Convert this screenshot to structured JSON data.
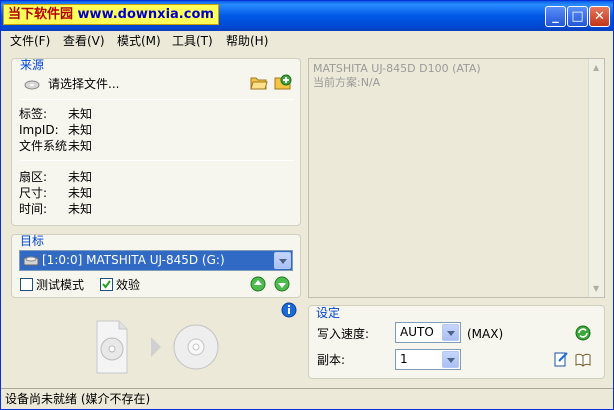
{
  "titlebar": {
    "brand_cn": "当下软件园",
    "brand_url": "www.downxia.com"
  },
  "menu": [
    "文件(F)",
    "查看(V)",
    "模式(M)",
    "工具(T)",
    "帮助(H)"
  ],
  "source": {
    "title": "来源",
    "select_file": "请选择文件...",
    "label_tag": "标签:",
    "value_tag": "未知",
    "label_impid": "ImpID:",
    "value_impid": "未知",
    "label_fs": "文件系统",
    "value_fs": "未知",
    "label_sector": "扇区:",
    "value_sector": "未知",
    "label_size": "尺寸:",
    "value_size": "未知",
    "label_time": "时间:",
    "value_time": "未知"
  },
  "target": {
    "title": "目标",
    "drive": "[1:0:0] MATSHITA UJ-845D (G:)",
    "test_mode": "测试模式",
    "test_mode_checked": false,
    "verify": "效验",
    "verify_checked": true
  },
  "info": {
    "line1": "MATSHITA UJ-845D D100 (ATA)",
    "line2": "当前方案:N/A"
  },
  "settings": {
    "title": "设定",
    "speed_label": "写入速度:",
    "speed_value": "AUTO",
    "speed_max": "(MAX)",
    "copies_label": "副本:",
    "copies_value": "1"
  },
  "status": {
    "text": "设备尚未就绪 (媒介不存在)"
  }
}
